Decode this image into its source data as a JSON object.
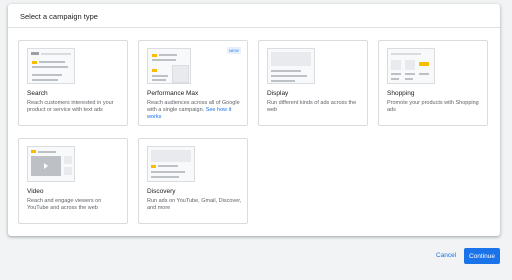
{
  "dialog": {
    "title": "Select a campaign type"
  },
  "cards": [
    {
      "title": "Search",
      "description": "Reach customers interested in your product or service with text ads"
    },
    {
      "title": "Performance Max",
      "description": "Reach audiences across all of Google with a single campaign.",
      "link": "See how it works",
      "badge": "NEW"
    },
    {
      "title": "Display",
      "description": "Run different kinds of ads across the web"
    },
    {
      "title": "Shopping",
      "description": "Promote your products with Shopping ads"
    },
    {
      "title": "Video",
      "description": "Reach and engage viewers on YouTube and across the web"
    },
    {
      "title": "Discovery",
      "description": "Run ads on YouTube, Gmail, Discover, and more"
    }
  ],
  "footer": {
    "cancel_label": "Cancel",
    "continue_label": "Continue"
  },
  "colors": {
    "accent": "#1a73e8",
    "highlight": "#fbbc04"
  }
}
